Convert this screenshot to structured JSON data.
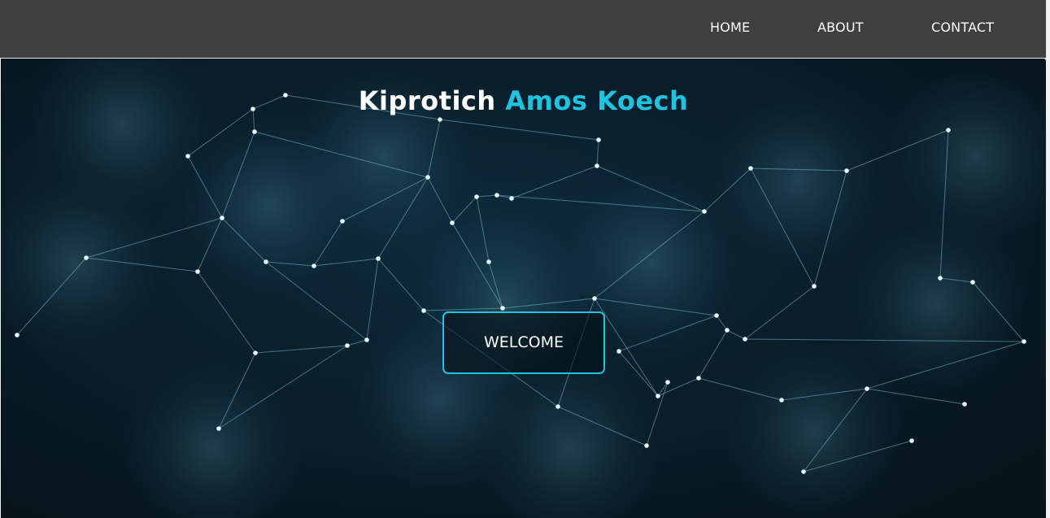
{
  "nav": {
    "items": [
      {
        "label": "HOME"
      },
      {
        "label": "ABOUT"
      },
      {
        "label": "CONTACT"
      }
    ]
  },
  "hero": {
    "title_first": "Kiprotich",
    "title_accent": "Amos Koech",
    "button_label": "WELCOME",
    "background": "network-graph-image"
  },
  "colors": {
    "navbar": "#3f3f3f",
    "accent": "#1ec3e0",
    "hero_bg": "#0a1f2c"
  }
}
